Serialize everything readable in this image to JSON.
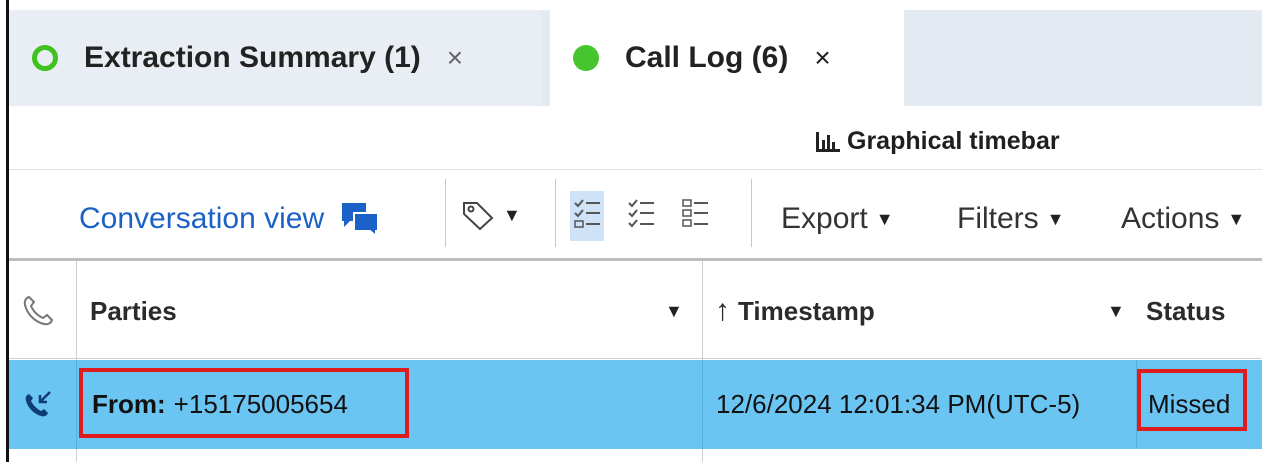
{
  "tabs": [
    {
      "label": "Extraction Summary (1)",
      "close": "×",
      "status_color": "#3fc11e",
      "active": false
    },
    {
      "label": "Call Log (6)",
      "close": "×",
      "status_color": "#47c52f",
      "active": true
    }
  ],
  "timebar": {
    "label": "Graphical timebar",
    "icon": "bar-chart-icon"
  },
  "toolbar": {
    "conversation_view": "Conversation view",
    "export": "Export",
    "filters": "Filters",
    "actions": "Actions",
    "accent_color": "#1a62c7"
  },
  "table": {
    "columns": {
      "type_icon": "phone-icon",
      "parties": "Parties",
      "timestamp_sort": "↑",
      "timestamp": "Timestamp",
      "status": "Status"
    },
    "rows": [
      {
        "type_icon": "incoming-call-icon",
        "from_label": "From:",
        "from_value": "+15175005654",
        "timestamp": "12/6/2024 12:01:34 PM(UTC-5)",
        "status": "Missed",
        "selected": true,
        "highlight_color": "#6bc5f2"
      }
    ]
  },
  "annotations": {
    "box_color": "#e01b1b"
  }
}
